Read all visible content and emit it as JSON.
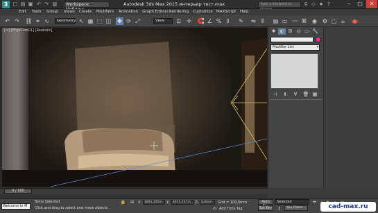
{
  "titlebar": {
    "workspace": "Workspace: Меблинь",
    "app_title": "Autodesk 3ds Max  2015     интерьер тест.max",
    "search_placeholder": "Type a keyword or phrase"
  },
  "menubar": {
    "items": [
      "Edit",
      "Tools",
      "Group",
      "Views",
      "Create",
      "Modifiers",
      "Animation",
      "Graph Editors",
      "Rendering",
      "Customize",
      "MAXScript",
      "Help"
    ]
  },
  "toolbar": {
    "filter_dropdown": "Geometry",
    "refcoord_dropdown": "View"
  },
  "viewport": {
    "label": "[+] [PhysCam01] [Realistic]"
  },
  "command_panel": {
    "modifier_list": "Modifier List"
  },
  "timeline": {
    "position": "0 / 100"
  },
  "status": {
    "maxscript_text": "Welcome to M",
    "selection": "None Selected",
    "prompt": "Click and drag to select and move objects",
    "x_label": "X:",
    "x_value": "1891,355m",
    "y_label": "Y:",
    "y_value": "4971,747m",
    "z_label": "Z:",
    "z_value": "0,0mm",
    "grid": "Grid = 100,0mm",
    "add_time_tag": "Add Time Tag",
    "auto_key": "Auto Key",
    "set_key": "Set Key",
    "selected_dropdown": "Selected",
    "key_filters": "Key Filters..."
  },
  "watermark": "cad-max.ru",
  "colors": {
    "ui_background": "#3a3a3a",
    "selection_accent": "#5d7fa8",
    "camera_frustum": "#d9c45a",
    "object_color": "#d33d8a"
  }
}
